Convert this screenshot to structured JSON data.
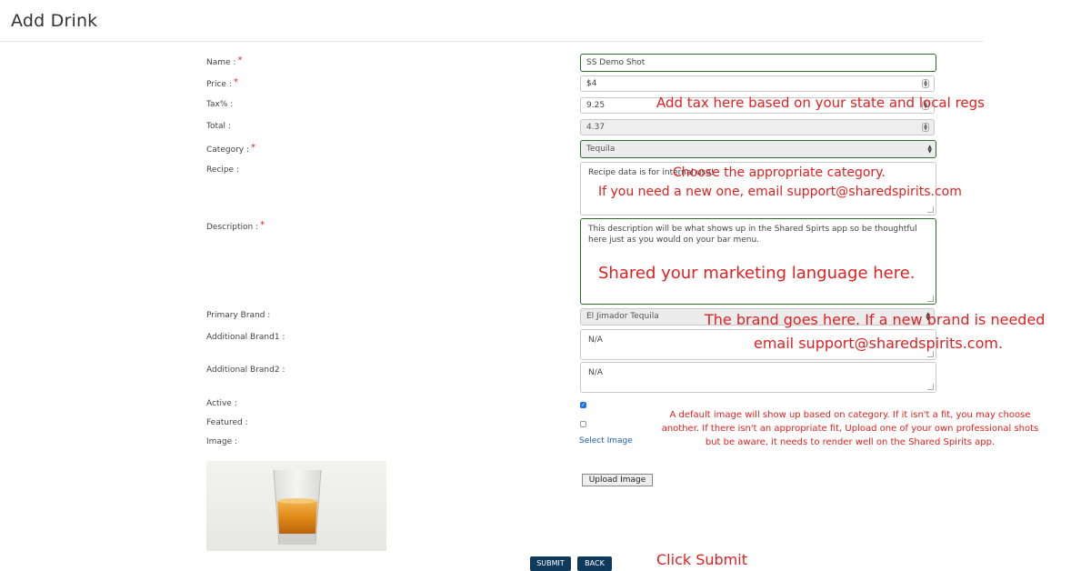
{
  "page": {
    "title": "Add Drink"
  },
  "form": {
    "labels": {
      "name": "Name :",
      "price": "Price :",
      "tax": "Tax% :",
      "total": "Total :",
      "category": "Category :",
      "recipe": "Recipe :",
      "description": "Description :",
      "primary_brand": "Primary Brand :",
      "additional_brand1": "Additional Brand1 :",
      "additional_brand2": "Additional Brand2 :",
      "active": "Active :",
      "featured": "Featured :",
      "image": "Image :"
    },
    "required_mark": "*",
    "values": {
      "name": "SS Demo Shot",
      "price_prefix": "$",
      "price": "4",
      "tax": "9.25",
      "total": "4.37",
      "category": "Tequila",
      "recipe": "Recipe data is for internal use!",
      "description": "This description will be what shows up in the Shared Spirts app so be thoughtful here just as you would on your bar menu.",
      "primary_brand": "El Jimador Tequila",
      "additional_brand1": "N/A",
      "additional_brand2": "N/A",
      "active": true,
      "featured": false
    },
    "select_image_label": "Select Image",
    "upload_image_label": "Upload Image",
    "submit_label": "SUBMIT",
    "back_label": "BACK"
  },
  "annotations": {
    "tax": "Add tax here based on your state and local regs",
    "category_line1": "Choose the appropriate category.",
    "category_line2": "If you need a new one, email support@sharedspirits.com",
    "description": "Shared your marketing language here.",
    "brand_line1": "The brand goes here. If a new brand is needed",
    "brand_line2": "email support@sharedspirits.com.",
    "image_line1": "A default image will show up based on category. If it isn't a fit, you may choose",
    "image_line2": "another. If there isn't an appropriate fit, Upload one of your own professional shots",
    "image_line3": "but be aware, it needs to render well on the Shared Spirits app.",
    "submit": "Click Submit"
  },
  "colors": {
    "annotation": "#e02020",
    "required": "#e02020",
    "button_dark": "#103a5c",
    "field_focus_border": "#2e6b2e",
    "link": "#1a5fb4"
  }
}
